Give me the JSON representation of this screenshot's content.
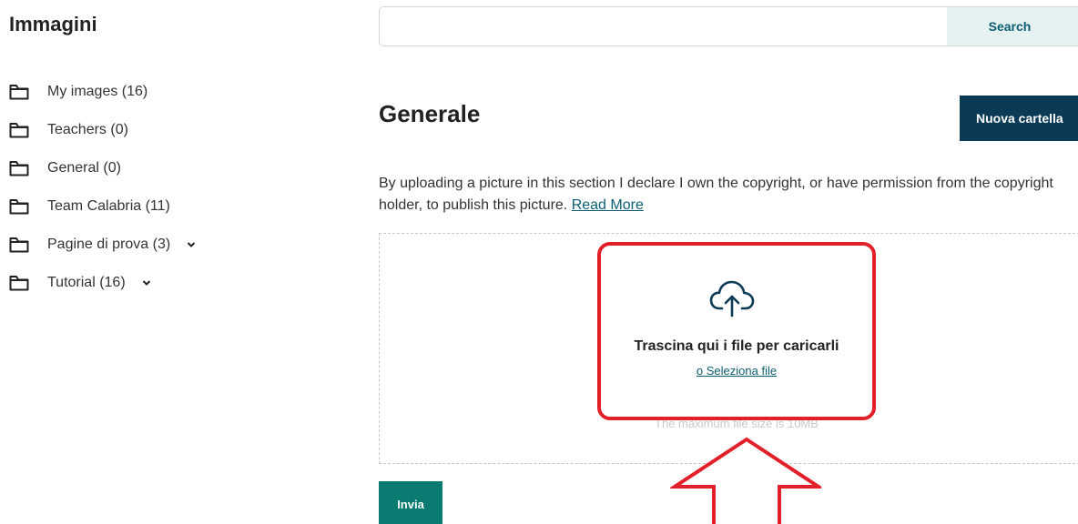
{
  "sidebar": {
    "title": "Immagini",
    "items": [
      {
        "label": "My images (16)",
        "expandable": false
      },
      {
        "label": "Teachers (0)",
        "expandable": false
      },
      {
        "label": "General (0)",
        "expandable": false
      },
      {
        "label": "Team Calabria (11)",
        "expandable": false
      },
      {
        "label": "Pagine di prova (3)",
        "expandable": true
      },
      {
        "label": "Tutorial (16)",
        "expandable": true
      }
    ]
  },
  "search": {
    "value": "",
    "placeholder": "",
    "button_label": "Search"
  },
  "main": {
    "title": "Generale",
    "new_folder_label": "Nuova cartella",
    "copyright_text": "By uploading a picture in this section I declare I own the copyright, or have permission from the copyright holder, to publish this picture.",
    "read_more_label": "Read More",
    "dropzone": {
      "icon": "cloud-upload-icon",
      "title": "Trascina qui i file per caricarli",
      "select_label": "o Seleziona file",
      "max_size_text": "The maximum file size is 10MB"
    },
    "submit_label": "Invia"
  },
  "annotation": {
    "highlight_color": "#e2202a",
    "arrow_color": "#e2202a"
  },
  "colors": {
    "primary_dark": "#0a3a55",
    "submit_green": "#0a7b70",
    "link": "#0b5e73",
    "search_button_bg": "#e6f1f1"
  }
}
